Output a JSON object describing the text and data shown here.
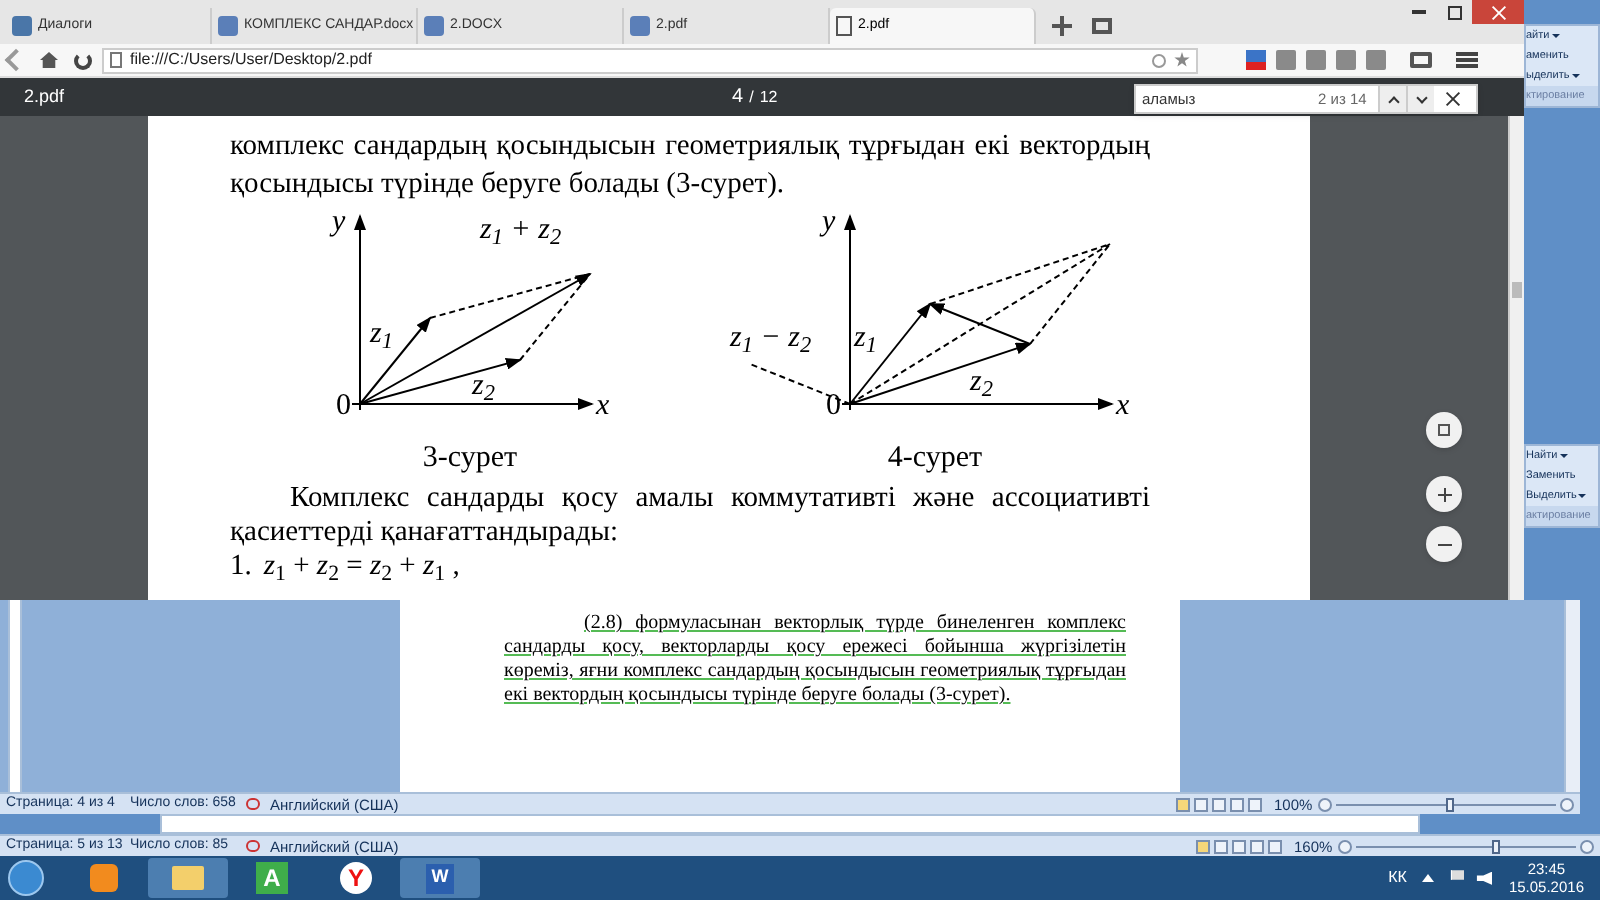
{
  "browser": {
    "tabs": [
      {
        "label": "Диалоги",
        "kind": "chat",
        "selected": false
      },
      {
        "label": "КОМПЛЕКС САНДАР.docx",
        "kind": "word",
        "selected": false
      },
      {
        "label": "2.DOCX",
        "kind": "word",
        "selected": false
      },
      {
        "label": "2.pdf",
        "kind": "word",
        "selected": false
      },
      {
        "label": "2.pdf",
        "kind": "file",
        "selected": true
      }
    ],
    "address": "file:///C:/Users/User/Desktop/2.pdf"
  },
  "pdf_toolbar": {
    "title": "2.pdf",
    "page": "4",
    "separator": "/",
    "page_total": "12"
  },
  "find_bar": {
    "query": "аламыз",
    "count": "2 из 14"
  },
  "pdf_page": {
    "lines": [
      "комплекс сандардың қосындысын геометриялық тұрғыдан екі вектордың",
      "қосындысы түрінде беруге болады (3-сурет)."
    ],
    "figures": [
      {
        "kind": "sum",
        "labels": {
          "y": "y",
          "sum": "z$_{1}$ + z$_{2}$",
          "z1": "z$_{1}$",
          "z2": "z$_{2}$",
          "origin": "0",
          "x": "x"
        },
        "caption": "3-сурет"
      },
      {
        "kind": "difference",
        "labels": {
          "y": "y",
          "difference": "z$_{1}$ − z$_{2}$",
          "z1": "z$_{1}$",
          "z2": "z$_{2}$",
          "origin": "0",
          "x": "x"
        },
        "caption": "4-сурет"
      }
    ],
    "paragraph": [
      "Комплекс сандарды қосу амалы коммутативті және ассоциативті",
      "қасиеттерді қанағаттандырады:"
    ],
    "equation": {
      "number": "1.",
      "formula": "*z*$_{1}$ + *z*$_{2}$ = *z*$_{2}$ + *z*$_{1}$ ,"
    }
  },
  "ribbon_groups": [
    {
      "items": [
        {
          "label": "айти",
          "menu": true
        },
        {
          "label": "аменить",
          "menu": false
        },
        {
          "label": "ыделить",
          "menu": true
        }
      ],
      "group": "ктирование"
    },
    {
      "items": [
        {
          "label": "Найти",
          "menu": true
        },
        {
          "label": "Заменить",
          "menu": false
        },
        {
          "label": "Выделить",
          "menu": true
        }
      ],
      "group": "актирование"
    }
  ],
  "word_document": {
    "paragraph": "(2.8) формуласынан векторлық түрде бинеленген комплекс сандарды қосу, векторларды қосу ережесі бойынша жүргізілетін көреміз, яғни комплекс сандардың қосындысын геометриялық тұрғыдан екі вектордың қосындысы түрінде беруге болады (3-сурет)."
  },
  "status_bars": [
    {
      "page": "Страница: 4 из 4",
      "words": "Число слов: 658",
      "language": "Английский (США)",
      "zoom": "100%",
      "level": 0.5
    },
    {
      "page": "Страница: 5 из 13",
      "words": "Число слов: 85",
      "language": "Английский (США)",
      "zoom": "160%",
      "level": 0.62
    }
  ],
  "taskbar": {
    "apps": [
      {
        "kind": "media"
      },
      {
        "kind": "folder"
      },
      {
        "kind": "letter-a",
        "label": "A"
      },
      {
        "kind": "browser",
        "label": "Y"
      },
      {
        "kind": "word",
        "label": "W"
      }
    ],
    "language": "КК",
    "time": "23:45",
    "date": "15.05.2016"
  }
}
